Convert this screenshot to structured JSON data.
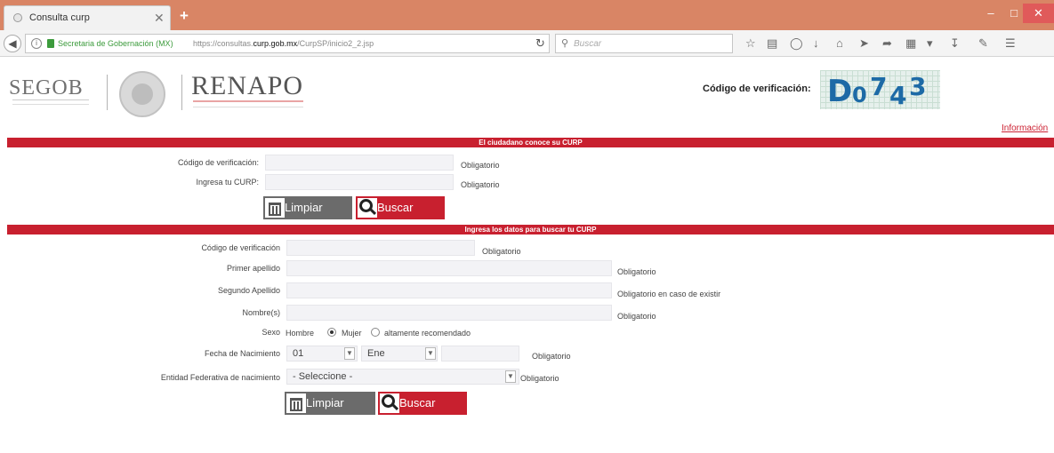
{
  "browser": {
    "tab_title": "Consulta curp",
    "tab_close": "✕",
    "new_tab": "+",
    "site_owner": "Secretaria de Gobernación (MX)",
    "url_prefix": "https://consultas.",
    "url_domain": "curp.gob.mx",
    "url_path": "/CurpSP/inicio2_2.jsp",
    "search_placeholder": "Buscar",
    "window_minimize": "–",
    "window_maximize": "□",
    "window_close": "✕"
  },
  "header": {
    "segob": "SEGOB",
    "renapo": "RENAPO",
    "captcha_label": "Código de verificación:",
    "captcha_chars": [
      "D",
      "0",
      "7",
      "4",
      "3"
    ],
    "info_link": "Información"
  },
  "section1": {
    "banner": "El ciudadano conoce su CURP",
    "code_label": "Código de verificación:",
    "code_value": "",
    "code_req": "Obligatorio",
    "curp_label": "Ingresa tu CURP:",
    "curp_value": "",
    "curp_req": "Obligatorio",
    "clear_label": "Limpiar",
    "search_label": "Buscar"
  },
  "section2": {
    "banner": "Ingresa los datos para buscar tu CURP",
    "code_label": "Código de verificación",
    "code_req": "Obligatorio",
    "apellido1_label": "Primer apellido",
    "apellido1_req": "Obligatorio",
    "apellido2_label": "Segundo Apellido",
    "apellido2_req": "Obligatorio en caso de existir",
    "nombre_label": "Nombre(s)",
    "nombre_req": "Obligatorio",
    "sexo_label": "Sexo",
    "sexo_hombre": "Hombre",
    "sexo_mujer": "Mujer",
    "sexo_note": "altamente recomendado",
    "fecha_label": "Fecha de Nacimiento",
    "fecha_dia": "01",
    "fecha_mes": "Ene",
    "fecha_anio": "",
    "fecha_req": "Obligatorio",
    "entidad_label": "Entidad Federativa de nacimiento",
    "entidad_value": "- Seleccione -",
    "entidad_req": "Obligatorio",
    "clear_label": "Limpiar",
    "search_label": "Buscar"
  },
  "colors": {
    "banner_red": "#c8202f",
    "titlebar": "#d98565",
    "captcha_text": "#1d6aa6"
  }
}
